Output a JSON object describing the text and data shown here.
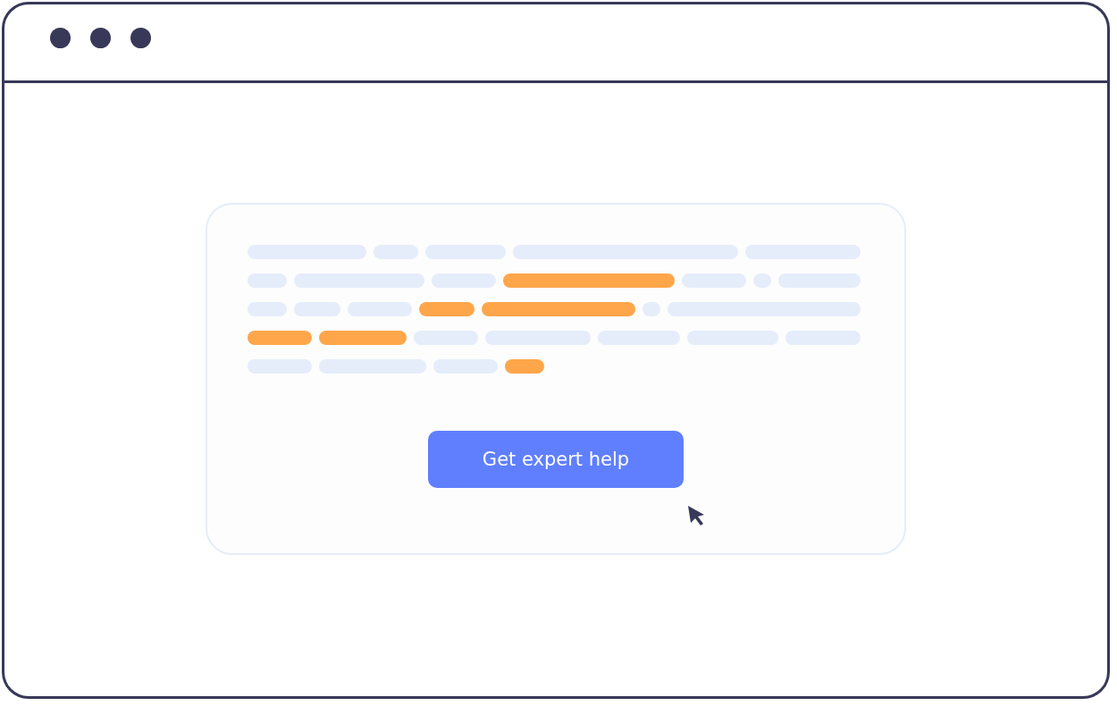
{
  "window": {
    "controls": [
      {
        "kind": "dot"
      },
      {
        "kind": "dot"
      },
      {
        "kind": "dot"
      }
    ]
  },
  "document": {
    "lines": [
      [
        {
          "highlighted": false
        },
        {
          "highlighted": false
        },
        {
          "highlighted": false
        },
        {
          "highlighted": false
        },
        {
          "highlighted": false
        }
      ],
      [
        {
          "highlighted": false
        },
        {
          "highlighted": false
        },
        {
          "highlighted": false
        },
        {
          "highlighted": true
        },
        {
          "highlighted": false
        },
        {
          "highlighted": false
        },
        {
          "highlighted": false
        }
      ],
      [
        {
          "highlighted": false
        },
        {
          "highlighted": false
        },
        {
          "highlighted": false
        },
        {
          "highlighted": true
        },
        {
          "highlighted": true
        },
        {
          "highlighted": false
        },
        {
          "highlighted": false
        }
      ],
      [
        {
          "highlighted": true
        },
        {
          "highlighted": true
        },
        {
          "highlighted": false
        },
        {
          "highlighted": false
        },
        {
          "highlighted": false
        },
        {
          "highlighted": false
        },
        {
          "highlighted": false
        }
      ],
      [
        {
          "highlighted": false
        },
        {
          "highlighted": false
        },
        {
          "highlighted": false
        },
        {
          "highlighted": true
        }
      ]
    ]
  },
  "button": {
    "label": "Get expert help"
  }
}
